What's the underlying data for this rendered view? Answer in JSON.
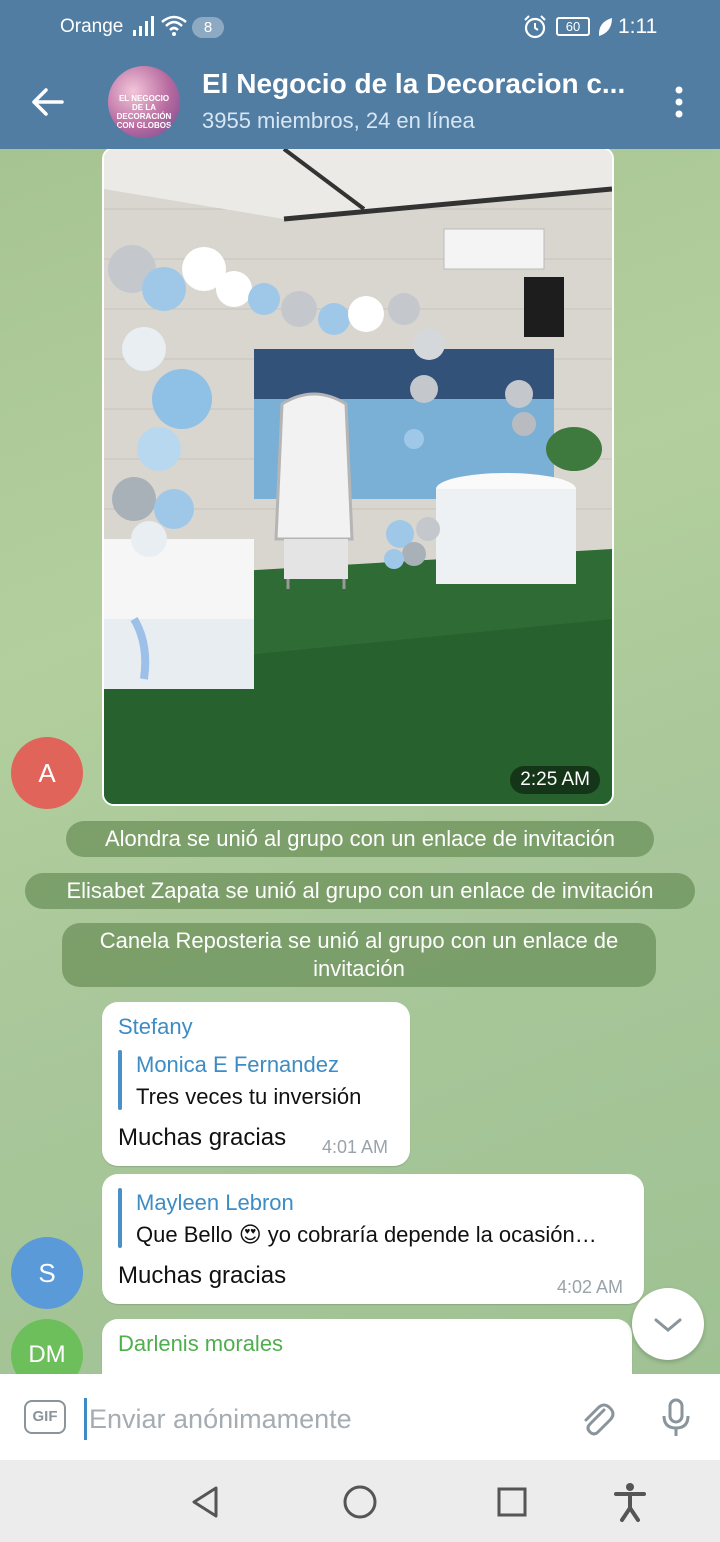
{
  "status_bar": {
    "carrier": "Orange",
    "notifications": "8",
    "battery": "60",
    "time": "1:11",
    "icons": [
      "signal-icon",
      "wifi-icon",
      "alarm-icon",
      "battery-icon",
      "leaf-icon"
    ]
  },
  "header": {
    "title": "El Negocio de la Decoracion c...",
    "subtitle": "3955 miembros, 24 en línea",
    "avatar_text": "EL NEGOCIO DE LA DECORACIÓN CON GLOBOS",
    "back_icon": "arrow-left-icon",
    "menu_icon": "more-vertical-icon"
  },
  "chat": {
    "photo_message": {
      "time": "2:25 AM",
      "avatar_initial": "A"
    },
    "service_messages": [
      "Alondra se unió al grupo con un enlace de invitación",
      "Elisabet Zapata se unió al grupo con un enlace de invitación",
      "Canela Reposteria se unió al grupo con un enlace de invitación"
    ],
    "messages": [
      {
        "sender": "Stefany",
        "reply_name": "Monica E Fernandez",
        "reply_text": "Tres veces tu inversión",
        "text": "Muchas gracias",
        "time": "4:01 AM"
      },
      {
        "reply_name": "Mayleen Lebron",
        "reply_text": "Que Bello 😍 yo cobraría depende la ocasión…",
        "text": "Muchas gracias",
        "time": "4:02 AM",
        "avatar_initial": "S"
      },
      {
        "sender": "Darlenis morales",
        "avatar_initial": "DM"
      }
    ],
    "colors": {
      "avatar_a": "#e0645a",
      "avatar_s": "#5b9ad9",
      "avatar_dm": "#6cbf5a",
      "sender_stefany": "#3d8cc4",
      "sender_darlenis": "#4fae4e"
    }
  },
  "input_bar": {
    "gif_label": "GIF",
    "placeholder": "Enviar anónimamente",
    "icons": [
      "gif-icon",
      "paperclip-icon",
      "microphone-icon"
    ]
  },
  "nav_bar": {
    "icons": [
      "back-triangle-icon",
      "home-circle-icon",
      "recents-square-icon",
      "accessibility-icon"
    ]
  }
}
